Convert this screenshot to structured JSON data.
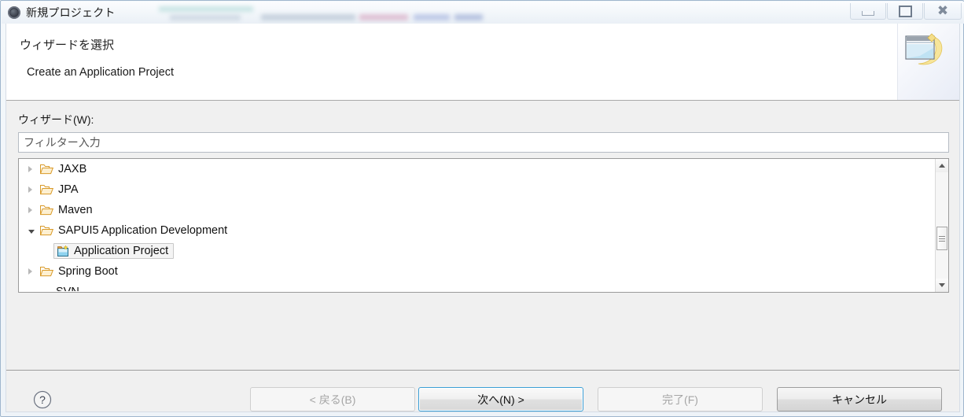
{
  "window": {
    "title": "新規プロジェクト",
    "app_icon": "eclipse-gear-icon",
    "controls": {
      "minimize": "minimize-icon",
      "restore": "restore-icon",
      "close": "close-icon"
    }
  },
  "header": {
    "title": "ウィザードを選択",
    "description": "Create an Application Project",
    "banner_icon": "new-wizard-banner-icon"
  },
  "form": {
    "wizard_label": "ウィザード(W):",
    "filter": {
      "value": "",
      "placeholder": "フィルター入力"
    }
  },
  "tree": {
    "items": [
      {
        "label": "JAXB",
        "icon": "folder-icon",
        "state": "collapsed",
        "level": 0,
        "selected": false
      },
      {
        "label": "JPA",
        "icon": "folder-icon",
        "state": "collapsed",
        "level": 0,
        "selected": false
      },
      {
        "label": "Maven",
        "icon": "folder-icon",
        "state": "collapsed",
        "level": 0,
        "selected": false
      },
      {
        "label": "SAPUI5 Application Development",
        "icon": "folder-icon",
        "state": "expanded",
        "level": 0,
        "selected": false
      },
      {
        "label": "Application Project",
        "icon": "project-icon",
        "state": "leaf",
        "level": 1,
        "selected": true
      },
      {
        "label": "Spring Boot",
        "icon": "folder-icon",
        "state": "collapsed",
        "level": 0,
        "selected": false
      },
      {
        "label": "SVN",
        "icon": "folder-icon",
        "state": "collapsed",
        "level": 0,
        "selected": false,
        "clipped": true
      }
    ],
    "scrollbar": {
      "up_icon": "scroll-up-icon",
      "down_icon": "scroll-down-icon",
      "thumb": "scroll-thumb"
    }
  },
  "footer": {
    "help_icon": "help-icon",
    "buttons": {
      "back": {
        "label": "< 戻る(B)",
        "enabled": false
      },
      "next": {
        "label": "次へ(N) >",
        "enabled": true,
        "default": true
      },
      "finish": {
        "label": "完了(F)",
        "enabled": false
      },
      "cancel": {
        "label": "キャンセル",
        "enabled": true
      }
    }
  },
  "colors": {
    "accent": "#3c9fd6",
    "folder": "#e8a33d",
    "dialog_bg": "#f0f0f0",
    "header_bg": "#ffffff"
  }
}
